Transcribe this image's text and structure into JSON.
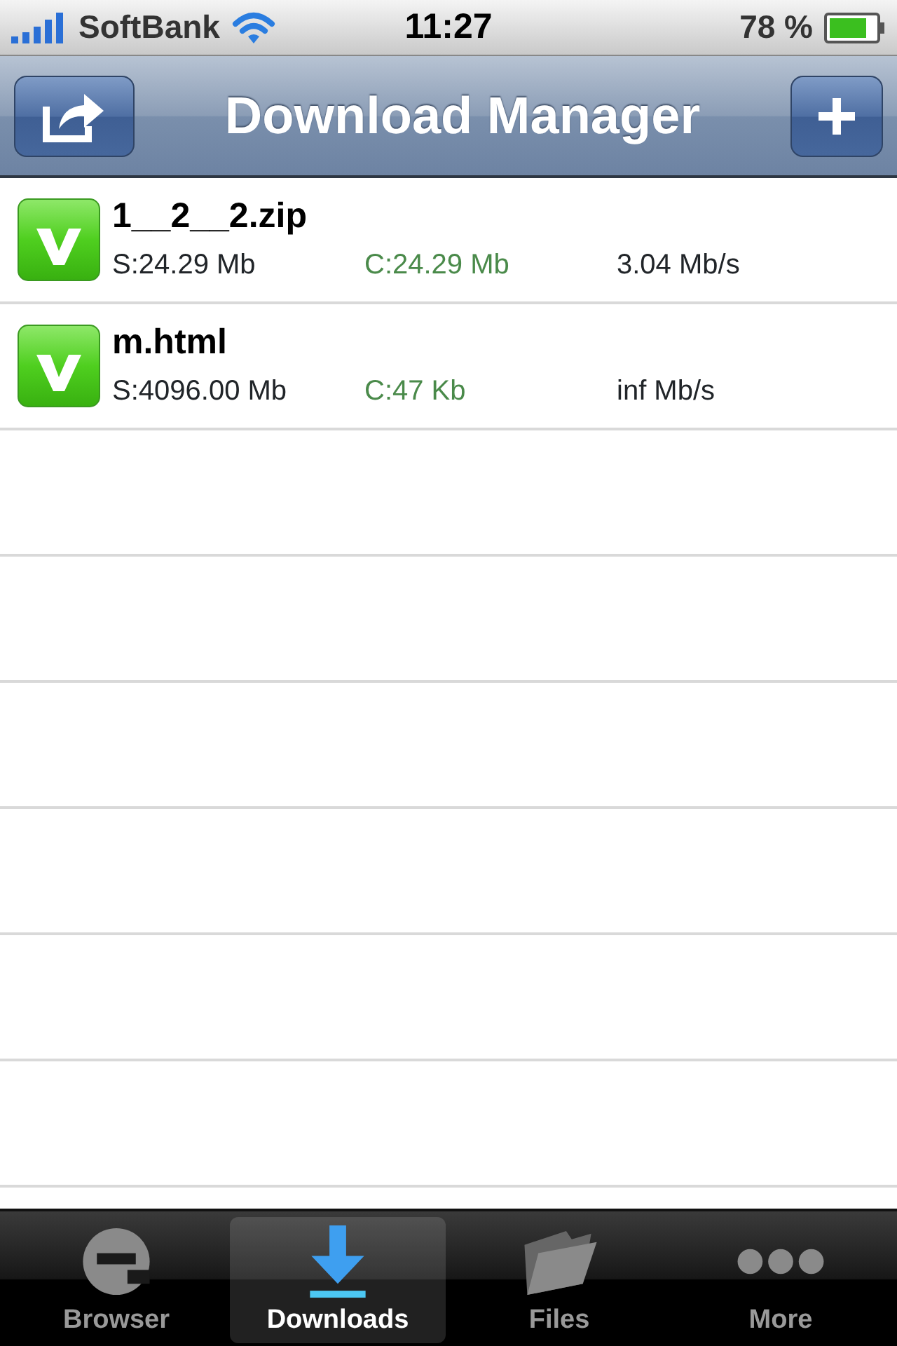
{
  "status_bar": {
    "carrier": "SoftBank",
    "time": "11:27",
    "battery": "78 %"
  },
  "nav_bar": {
    "title": "Download Manager"
  },
  "downloads": [
    {
      "name": "1__2__2.zip",
      "size": "S:24.29 Mb",
      "completed": "C:24.29 Mb",
      "speed": "3.04 Mb/s",
      "done": true
    },
    {
      "name": "m.html",
      "size": "S:4096.00 Mb",
      "completed": "C:47 Kb",
      "speed": "inf Mb/s",
      "done": true
    }
  ],
  "tab_bar": [
    {
      "label": "Browser",
      "selected": false
    },
    {
      "label": "Downloads",
      "selected": true
    },
    {
      "label": "Files",
      "selected": false
    },
    {
      "label": "More",
      "selected": false
    }
  ]
}
